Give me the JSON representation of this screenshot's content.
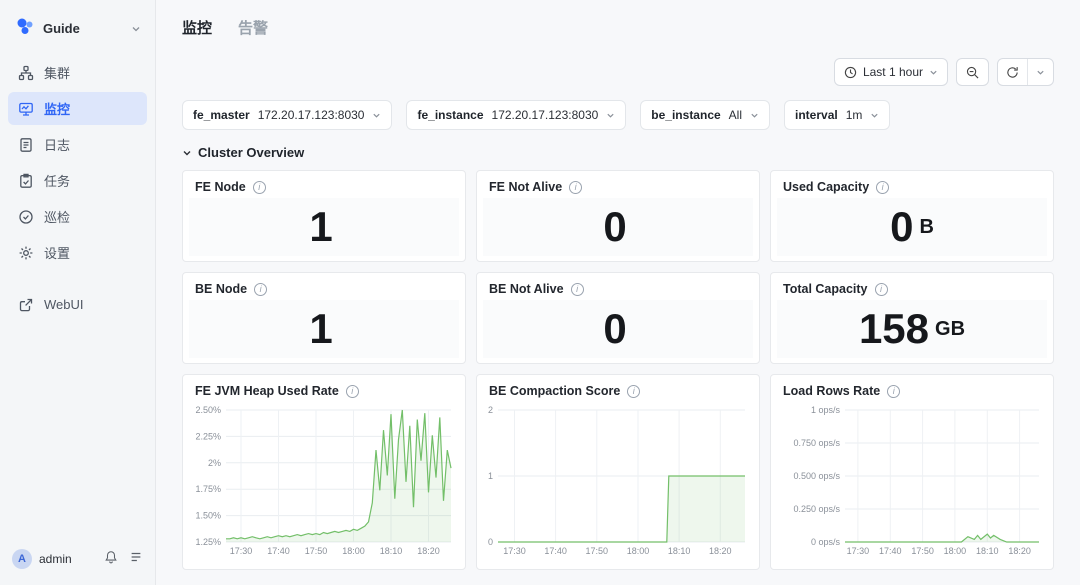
{
  "colors": {
    "accent": "#3066f5",
    "chart_green": "#73bf69"
  },
  "icons": {
    "info_glyph": "i"
  },
  "sidebar": {
    "product": "Guide",
    "items": [
      {
        "label": "集群"
      },
      {
        "label": "监控",
        "selected": true
      },
      {
        "label": "日志"
      },
      {
        "label": "任务"
      },
      {
        "label": "巡检"
      },
      {
        "label": "设置"
      },
      {
        "label": "WebUI"
      }
    ],
    "footer": {
      "username": "admin",
      "avatar_letter": "A"
    }
  },
  "header": {
    "tabs": [
      {
        "label": "监控",
        "active": true
      },
      {
        "label": "告警",
        "active": false
      }
    ],
    "time_picker": {
      "label": "Last 1 hour"
    }
  },
  "filters": [
    {
      "label": "fe_master",
      "value": "172.20.17.123:8030"
    },
    {
      "label": "fe_instance",
      "value": "172.20.17.123:8030"
    },
    {
      "label": "be_instance",
      "value": "All"
    },
    {
      "label": "interval",
      "value": "1m"
    }
  ],
  "section_title": "Cluster Overview",
  "stats": [
    {
      "title": "FE Node",
      "value": "1",
      "unit": ""
    },
    {
      "title": "FE Not Alive",
      "value": "0",
      "unit": ""
    },
    {
      "title": "Used Capacity",
      "value": "0",
      "unit": "B"
    },
    {
      "title": "BE Node",
      "value": "1",
      "unit": ""
    },
    {
      "title": "BE Not Alive",
      "value": "0",
      "unit": ""
    },
    {
      "title": "Total Capacity",
      "value": "158",
      "unit": "GB"
    }
  ],
  "chart_data": [
    {
      "type": "line",
      "title": "FE JVM Heap Used Rate",
      "color": "#73bf69",
      "xlim": [
        0,
        60
      ],
      "ylim": [
        1.25,
        2.5
      ],
      "x_ticks": [
        {
          "v": 4,
          "label": "17:30"
        },
        {
          "v": 14,
          "label": "17:40"
        },
        {
          "v": 24,
          "label": "17:50"
        },
        {
          "v": 34,
          "label": "18:00"
        },
        {
          "v": 44,
          "label": "18:10"
        },
        {
          "v": 54,
          "label": "18:20"
        }
      ],
      "y_ticks": [
        {
          "v": 2.5,
          "label": "2.50%"
        },
        {
          "v": 2.25,
          "label": "2.25%"
        },
        {
          "v": 2.0,
          "label": "2%"
        },
        {
          "v": 1.75,
          "label": "1.75%"
        },
        {
          "v": 1.5,
          "label": "1.50%"
        },
        {
          "v": 1.25,
          "label": "1.25%"
        }
      ],
      "x": null,
      "values": [
        1.28,
        1.28,
        1.29,
        1.28,
        1.29,
        1.28,
        1.29,
        1.3,
        1.29,
        1.28,
        1.29,
        1.3,
        1.29,
        1.3,
        1.31,
        1.3,
        1.31,
        1.3,
        1.31,
        1.32,
        1.31,
        1.32,
        1.33,
        1.32,
        1.33,
        1.32,
        1.34,
        1.33,
        1.34,
        1.35,
        1.34,
        1.35,
        1.36,
        1.35,
        1.37,
        1.36,
        1.38,
        1.4,
        1.44,
        1.62,
        2.12,
        1.74,
        2.31,
        1.88,
        2.46,
        1.66,
        2.22,
        2.5,
        1.82,
        2.35,
        1.58,
        2.41,
        2.02,
        2.47,
        1.72,
        2.26,
        1.86,
        2.43,
        1.64,
        2.12,
        1.95
      ]
    },
    {
      "type": "line",
      "title": "BE Compaction Score",
      "color": "#73bf69",
      "xlim": [
        0,
        60
      ],
      "ylim": [
        0,
        2
      ],
      "x_ticks": [
        {
          "v": 4,
          "label": "17:30"
        },
        {
          "v": 14,
          "label": "17:40"
        },
        {
          "v": 24,
          "label": "17:50"
        },
        {
          "v": 34,
          "label": "18:00"
        },
        {
          "v": 44,
          "label": "18:10"
        },
        {
          "v": 54,
          "label": "18:20"
        }
      ],
      "y_ticks": [
        {
          "v": 2,
          "label": "2"
        },
        {
          "v": 1,
          "label": "1"
        },
        {
          "v": 0,
          "label": "0"
        }
      ],
      "x": [
        0,
        41,
        41.5,
        60
      ],
      "values": [
        0,
        0,
        1,
        1
      ]
    },
    {
      "type": "line",
      "title": "Load Rows Rate",
      "color": "#73bf69",
      "xlim": [
        0,
        60
      ],
      "ylim": [
        0,
        1
      ],
      "x_ticks": [
        {
          "v": 4,
          "label": "17:30"
        },
        {
          "v": 14,
          "label": "17:40"
        },
        {
          "v": 24,
          "label": "17:50"
        },
        {
          "v": 34,
          "label": "18:00"
        },
        {
          "v": 44,
          "label": "18:10"
        },
        {
          "v": 54,
          "label": "18:20"
        }
      ],
      "y_ticks": [
        {
          "v": 1,
          "label": "1 ops/s"
        },
        {
          "v": 0.75,
          "label": "0.750 ops/s"
        },
        {
          "v": 0.5,
          "label": "0.500 ops/s"
        },
        {
          "v": 0.25,
          "label": "0.250 ops/s"
        },
        {
          "v": 0,
          "label": "0 ops/s"
        }
      ],
      "x": [
        0,
        36,
        38,
        40,
        41,
        42,
        44,
        45,
        46,
        48,
        50,
        60
      ],
      "values": [
        0,
        0,
        0.04,
        0.02,
        0.05,
        0.02,
        0.06,
        0.03,
        0.05,
        0.02,
        0,
        0
      ]
    }
  ]
}
